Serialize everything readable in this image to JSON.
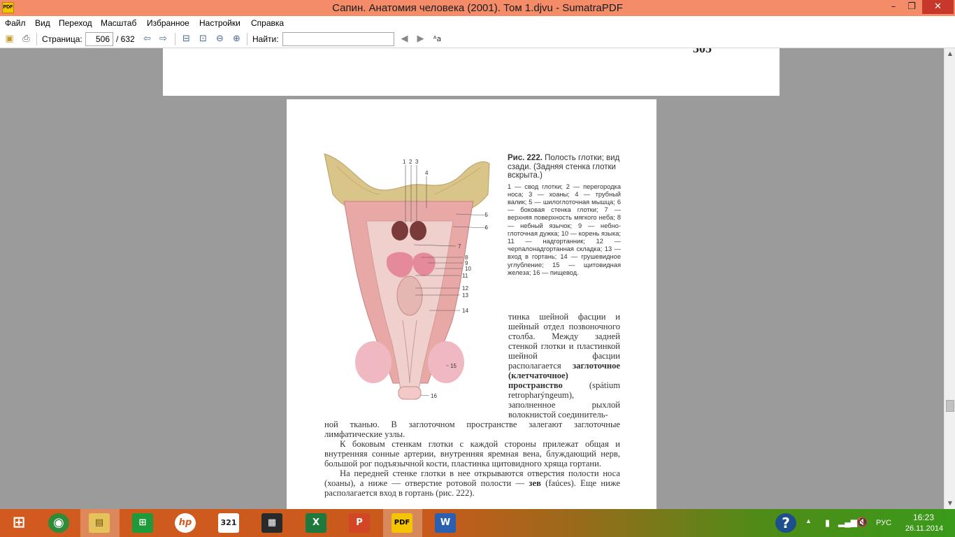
{
  "window": {
    "title": "Сапин. Анатомия человека (2001). Том 1.djvu - SumatraPDF",
    "app_icon_text": "PDF",
    "minimize": "–",
    "maximize": "❐",
    "close": "✕"
  },
  "menu": [
    "Файл",
    "Вид",
    "Переход",
    "Масштаб",
    "Избранное",
    "Настройки",
    "Справка"
  ],
  "toolbar": {
    "page_label": "Страница:",
    "page_value": "506",
    "page_total": "/ 632",
    "find_label": "Найти:",
    "find_value": "",
    "icons": [
      "open-icon",
      "print-icon",
      "back-icon",
      "forward-icon",
      "fit-page-icon",
      "fit-width-icon",
      "zoom-out-icon",
      "zoom-in-icon",
      "find-prev-icon",
      "find-next-icon",
      "match-case-icon"
    ]
  },
  "document": {
    "prev_page_number": "505",
    "caption": {
      "fig_label": "Рис. 222.",
      "title_rest": " Полость глотки; вид сзади. (Задняя стенка глотки вскрыта.)",
      "legend": "1 — свод глотки; 2 — перегородка носа; 3 — хоаны; 4 — трубный валик; 5 — шилоглоточная мышца; 6 — боковая стенка глотки; 7 — верхняя поверхность мягкого неба; 8 — небный язычок; 9 — небно-глоточная дужка; 10 — корень языка; 11 — надгортанник; 12 — черпалонадгортанная складка; 13 — вход в гортань; 14 — грушевидное углубление; 15 — щитовидная железа; 16 — пищевод."
    },
    "figure_labels": [
      "1",
      "2",
      "3",
      "4",
      "5",
      "6",
      "7",
      "8",
      "9",
      "10",
      "11",
      "12",
      "13",
      "14",
      "15",
      "16"
    ],
    "text_right_1": "тинка шейной фасции и шейный отдел позвоночного столба. Между задней стенкой глотки и пластинкой шейной фасции располагается ",
    "text_right_bold": "заглоточное (клетчаточное) пространство",
    "text_right_2": " (spátium retropharýngeum), заполненное рыхлой волокнистой соединитель-",
    "para1": "ной тканью. В заглоточном пространстве залегают заглоточные лимфатические узлы.",
    "para2": "К боковым стенкам глотки с каждой стороны прилежат общая и внутренняя сонные артерии, внутренняя яремная вена, блуждающий нерв, большой рог подъязычной кости, пластинка щитовидного хряща гортани.",
    "para3_a": "На передней стенке глотки в нее открываются отверстия полости носа (хоаны), а ниже — отверстие ротовой полости — ",
    "para3_bold": "зев",
    "para3_b": " (faúces). Еще ниже располагается вход в гортань (рис. 222)."
  },
  "scrollbar": {
    "up": "▲",
    "down": "▼",
    "position": 0.8
  },
  "taskbar": {
    "apps": [
      {
        "name": "windows-start",
        "glyph": "⊞"
      },
      {
        "name": "chrome",
        "glyph": "◉"
      },
      {
        "name": "file-explorer",
        "glyph": "▤"
      },
      {
        "name": "store",
        "glyph": "⊞"
      },
      {
        "name": "hp",
        "glyph": "hp"
      },
      {
        "name": "media-player-321",
        "glyph": "321"
      },
      {
        "name": "app-tiles",
        "glyph": "▦"
      },
      {
        "name": "excel",
        "glyph": "X"
      },
      {
        "name": "powerpoint",
        "glyph": "P"
      },
      {
        "name": "sumatrapdf",
        "glyph": "PDF"
      },
      {
        "name": "word",
        "glyph": "W"
      }
    ],
    "help": "?",
    "tray_arrow": "▲",
    "language": "РУС",
    "time": "16:23",
    "date": "26.11.2014"
  },
  "colors": {
    "titlebar": "#f48c6a",
    "close_button": "#c7372a",
    "background": "#9b9b9b"
  }
}
